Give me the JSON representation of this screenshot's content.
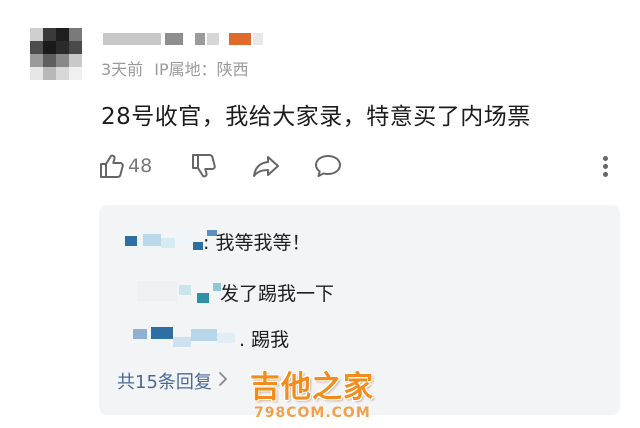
{
  "comment": {
    "time": "3天前",
    "ip_location": "IP属地：陕西",
    "text": "28号收官，我给大家录，特意买了内场票",
    "likes": "48"
  },
  "actions": {
    "like_icon": "thumbs-up-icon",
    "dislike_icon": "thumbs-down-icon",
    "share_icon": "share-arrow-icon",
    "reply_icon": "speech-bubble-icon",
    "more_icon": "vertical-ellipsis-icon"
  },
  "replies": [
    {
      "text": ": 我等我等！"
    },
    {
      "text": "发了踢我一下"
    },
    {
      "text": ". 踢我"
    }
  ],
  "more_replies": "共15条回复",
  "watermark": {
    "title": "吉他之家",
    "url": "798COM.COM"
  },
  "colors": {
    "link": "#4a6a96",
    "watermark": "#f28c1b",
    "reply_bg": "#f3f4f6",
    "mosaic_accent": "#2d6fa3"
  }
}
